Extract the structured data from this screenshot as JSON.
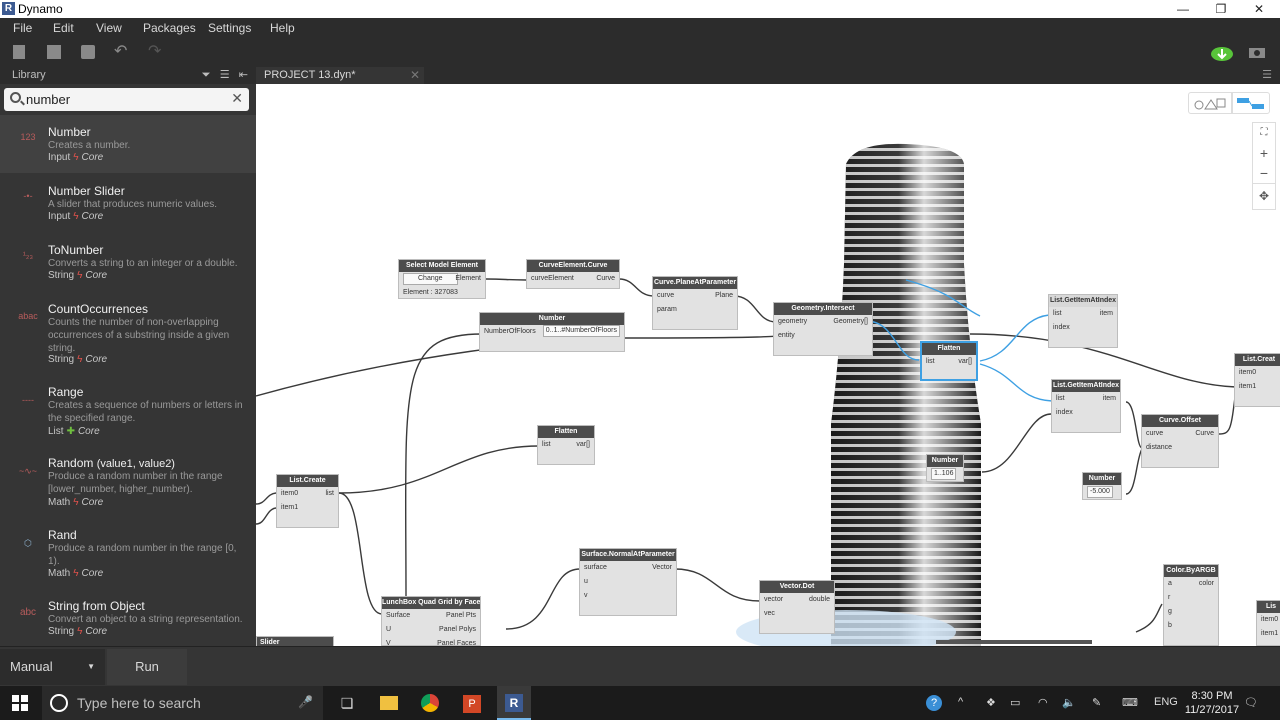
{
  "window": {
    "app_icon": "R",
    "title": "Dynamo",
    "minimize": "—",
    "maximize": "❐",
    "close": "✕"
  },
  "menu": [
    "File",
    "Edit",
    "View",
    "Packages",
    "Settings",
    "Help"
  ],
  "library": {
    "title": "Library",
    "search_value": "number",
    "results": [
      {
        "icon": "123",
        "name": "Number",
        "name_suffix": "",
        "desc": "Creates a number.",
        "category": "Input",
        "lib": "Core",
        "lib_icon": "bolt"
      },
      {
        "icon": "-•-",
        "name": "Number Slider",
        "name_suffix": "",
        "desc": "A slider that produces numeric values.",
        "category": "Input",
        "lib": "Core",
        "lib_icon": "bolt"
      },
      {
        "icon": "¹₂₃",
        "name": "ToNumber",
        "name_suffix": "",
        "desc": "Converts a string to an integer or a double.",
        "category": "String",
        "lib": "Core",
        "lib_icon": "bolt"
      },
      {
        "icon": "abac",
        "name": "CountOccurrences",
        "name_suffix": "",
        "desc": "Counts the number of non-overlapping occurrences of a substring inside a given string.",
        "category": "String",
        "lib": "Core",
        "lib_icon": "bolt"
      },
      {
        "icon": "----",
        "name": "Range",
        "name_suffix": "",
        "desc": "Creates a sequence of numbers or letters in the specified range.",
        "category": "List",
        "lib": "Core",
        "lib_icon": "plus"
      },
      {
        "icon": "~∿~",
        "name": "Random",
        "name_suffix": "(value1, value2)",
        "desc": "Produce a random number in the range [lower_number, higher_number).",
        "category": "Math",
        "lib": "Core",
        "lib_icon": "bolt"
      },
      {
        "icon": "⬡",
        "name": "Rand",
        "name_suffix": "",
        "desc": "Produce a random number in the range [0, 1).",
        "category": "Math",
        "lib": "Core",
        "lib_icon": "bolt"
      },
      {
        "icon": "abc",
        "name": "String from Object",
        "name_suffix": "",
        "desc": "Convert an object to a string representation.",
        "category": "String",
        "lib": "Core",
        "lib_icon": "bolt"
      }
    ]
  },
  "tab": {
    "label": "PROJECT 13.dyn*",
    "close": "✕"
  },
  "nodes": {
    "select_model": {
      "title": "Select Model Element",
      "button": "Change",
      "out": "Element",
      "info": "Element : 327083"
    },
    "curve_element": {
      "title": "CurveElement.Curve",
      "in": "curveElement",
      "out": "Curve"
    },
    "plane_at_param": {
      "title": "Curve.PlaneAtParameter",
      "in1": "curve",
      "in2": "param",
      "out": "Plane"
    },
    "number1": {
      "title": "Number",
      "in": "NumberOfFloors",
      "value": "0..1..#NumberOfFloors",
      "arrow": ">"
    },
    "geom_intersect": {
      "title": "Geometry.Intersect",
      "in1": "geometry",
      "in2": "entity",
      "out": "Geometry[]"
    },
    "flatten_sel": {
      "title": "Flatten",
      "in": "list",
      "out": "var[]"
    },
    "get_item1": {
      "title": "List.GetItemAtIndex",
      "in1": "list",
      "in2": "index",
      "out": "item"
    },
    "get_item2": {
      "title": "List.GetItemAtIndex",
      "in1": "list",
      "in2": "index",
      "out": "item"
    },
    "list_create_right": {
      "title": "List.Creat",
      "in1": "item0",
      "in2": "item1"
    },
    "curve_offset": {
      "title": "Curve.Offset",
      "in1": "curve",
      "in2": "distance",
      "out": "Curve"
    },
    "number2": {
      "title": "Number",
      "value": "1..106"
    },
    "number3": {
      "title": "Number",
      "value": "-5.000"
    },
    "flatten2": {
      "title": "Flatten",
      "in": "list",
      "out": "var[]"
    },
    "list_create": {
      "title": "List.Create",
      "in1": "item0",
      "in2": "item1",
      "out": "list"
    },
    "surface_normal": {
      "title": "Surface.NormalAtParameter",
      "in1": "surface",
      "in2": "u",
      "in3": "v",
      "out": "Vector"
    },
    "vector_dot": {
      "title": "Vector.Dot",
      "in1": "vector",
      "in2": "vec",
      "out": "double"
    },
    "lunchbox": {
      "title": "LunchBox Quad Grid by Face",
      "in1": "Surface",
      "in2": "U",
      "in3": "V",
      "out1": "Panel Pts",
      "out2": "Panel Polys",
      "out3": "Panel Faces"
    },
    "color_argb": {
      "title": "Color.ByARGB",
      "in1": "a",
      "in2": "r",
      "in3": "g",
      "in4": "b",
      "out": "color"
    },
    "list_bottom_right": {
      "title": "Lis",
      "in1": "item0",
      "in2": "item1"
    },
    "slider": {
      "title": "Slider"
    }
  },
  "run": {
    "mode": "Manual",
    "button": "Run"
  },
  "taskbar": {
    "search_placeholder": "Type here to search",
    "lang": "ENG",
    "time": "8:30 PM",
    "date": "11/27/2017"
  },
  "colors": {
    "chrome": "#2c2c2c",
    "panel": "#353535",
    "accent_blue": "#3ea0e3",
    "node_header": "#4c4c4c",
    "bolt_red": "#e0524c",
    "plus_green": "#6fbf3f"
  }
}
